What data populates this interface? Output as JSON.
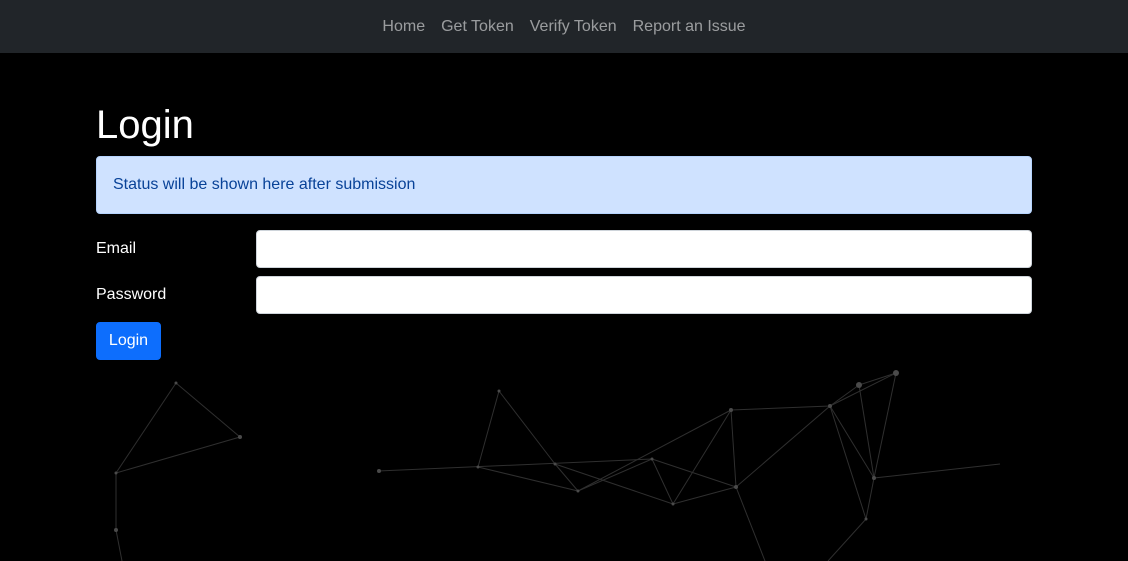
{
  "navbar": {
    "items": [
      {
        "label": "Home"
      },
      {
        "label": "Get Token"
      },
      {
        "label": "Verify Token"
      },
      {
        "label": "Report an Issue"
      }
    ]
  },
  "main": {
    "title": "Login",
    "status_message": "Status will be shown here after submission",
    "email_label": "Email",
    "email_value": "",
    "password_label": "Password",
    "password_value": "",
    "login_button": "Login"
  },
  "colors": {
    "navbar_bg": "#212529",
    "page_bg": "#000000",
    "alert_bg": "#cfe2ff",
    "alert_text": "#084298",
    "primary": "#0d6efd"
  }
}
